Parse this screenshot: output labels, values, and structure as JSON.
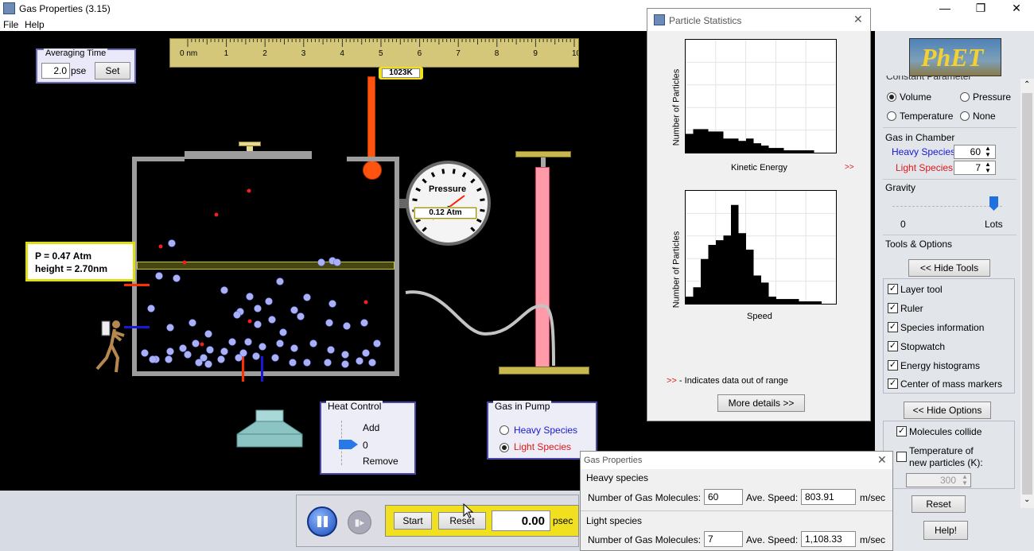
{
  "window": {
    "title": "Gas Properties (3.15)",
    "minimize": "—",
    "maximize": "❐",
    "close": "✕"
  },
  "menu": {
    "file": "File",
    "help": "Help"
  },
  "averaging": {
    "legend": "Averaging Time",
    "value": "2.0",
    "unit": "pse",
    "set_label": "Set"
  },
  "ruler": {
    "ticks": [
      "0 nm",
      "1",
      "2",
      "3",
      "4",
      "5",
      "6",
      "7",
      "8",
      "9",
      "10"
    ]
  },
  "thermometer": {
    "reading": "1023K"
  },
  "gauge": {
    "label": "Pressure",
    "reading": "0.12 Atm"
  },
  "layer_label": {
    "pressure": "P = 0.47 Atm",
    "height": "height = 2.70nm"
  },
  "heat_control": {
    "legend": "Heat Control",
    "add": "Add",
    "value": "0",
    "remove": "Remove"
  },
  "gas_in_pump": {
    "legend": "Gas in Pump",
    "heavy": "Heavy Species",
    "light": "Light Species",
    "selected": "light"
  },
  "controls": {
    "start": "Start",
    "reset": "Reset",
    "time": "0.00",
    "unit": "psec"
  },
  "particle_stats": {
    "title": "Particle Statistics",
    "y_label": "Number of Particles",
    "ke_label": "Kinetic Energy",
    "speed_label": "Speed",
    "out_of_range": ">>",
    "note_marker": ">>",
    "note": " - Indicates data out of range",
    "more_details": "More details >>",
    "ke_hist": [
      8,
      10,
      10,
      9,
      9,
      6,
      6,
      5,
      6,
      4,
      3,
      2,
      2,
      1,
      1,
      1,
      1,
      0,
      0,
      0
    ],
    "speed_hist": [
      3,
      7,
      19,
      25,
      27,
      29,
      42,
      30,
      23,
      12,
      9,
      3,
      2,
      2,
      2,
      1,
      1,
      1,
      0,
      0
    ]
  },
  "gas_properties": {
    "title": "Gas Properties",
    "heavy_header": "Heavy species",
    "light_header": "Light species",
    "count_label": "Number of Gas Molecules:",
    "speed_label": "Ave. Speed:",
    "unit": "m/sec",
    "heavy_count": "60",
    "heavy_speed": "803.91",
    "light_count": "7",
    "light_speed": "1,108.33"
  },
  "right_panel": {
    "logo": "PhET",
    "constant_parameter": "Constant Parameter",
    "volume": "Volume",
    "pressure": "Pressure",
    "temperature": "Temperature",
    "none": "None",
    "gas_in_chamber": "Gas in Chamber",
    "heavy_species": "Heavy Species",
    "heavy_count": "60",
    "light_species": "Light Species",
    "light_count": "7",
    "gravity": "Gravity",
    "gravity_min": "0",
    "gravity_max": "Lots",
    "gravity_level": 1.0,
    "tools_options": "Tools & Options",
    "hide_tools": "<< Hide Tools",
    "tools": [
      "Layer tool",
      "Ruler",
      "Species information",
      "Stopwatch",
      "Energy histograms",
      "Center of mass markers"
    ],
    "hide_options": "<< Hide Options",
    "molecules_collide": "Molecules collide",
    "temp_new_1": "Temperature of",
    "temp_new_2": "new particles (K):",
    "temp_value": "300",
    "reset": "Reset",
    "help": "Help!"
  },
  "colors": {
    "heavy": "#1818d8",
    "light": "#e01818",
    "gauge_box": "#f0e020",
    "panel_border": "#4848a8"
  }
}
